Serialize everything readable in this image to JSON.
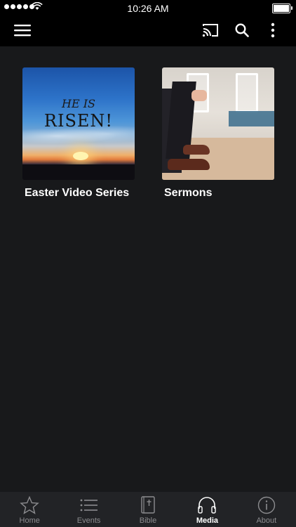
{
  "status_bar": {
    "time": "10:26 AM"
  },
  "navbar": {
    "icons": [
      "menu-icon",
      "cast-icon",
      "search-icon",
      "more-vertical-icon"
    ]
  },
  "media_items": [
    {
      "title": "Easter Video Series",
      "image_text_line1": "HE IS",
      "image_text_line2": "RISEN!"
    },
    {
      "title": "Sermons"
    }
  ],
  "tabs": [
    {
      "label": "Home",
      "icon": "star-icon",
      "active": false
    },
    {
      "label": "Events",
      "icon": "list-icon",
      "active": false
    },
    {
      "label": "Bible",
      "icon": "bible-icon",
      "active": false
    },
    {
      "label": "Media",
      "icon": "headphones-icon",
      "active": true
    },
    {
      "label": "About",
      "icon": "info-icon",
      "active": false
    }
  ],
  "colors": {
    "background": "#18191b",
    "bar": "#000000",
    "tab_active": "#ffffff",
    "tab_inactive": "#8c8c8f"
  }
}
